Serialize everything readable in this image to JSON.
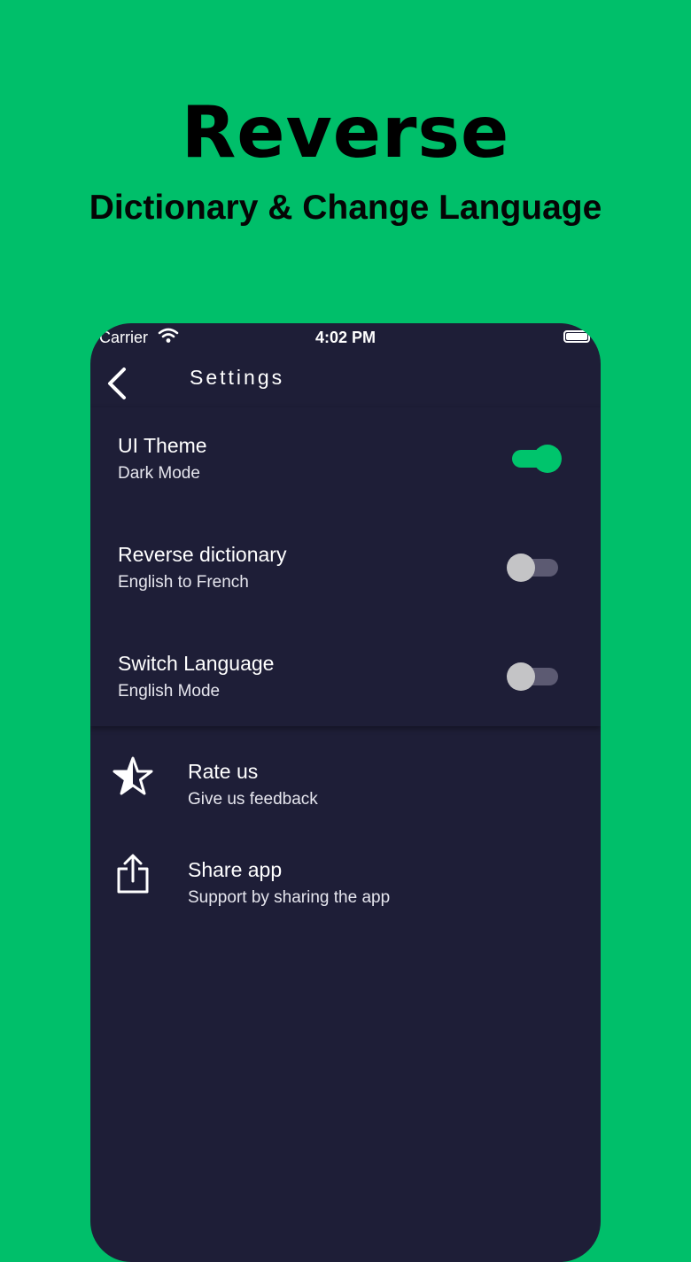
{
  "promo": {
    "title": "Reverse",
    "subtitle": "Dictionary & Change Language"
  },
  "status_bar": {
    "carrier": "Carrier",
    "time": "4:02 PM"
  },
  "nav": {
    "title": "Settings"
  },
  "settings": [
    {
      "title": "UI Theme",
      "subtitle": "Dark Mode",
      "enabled": true
    },
    {
      "title": "Reverse dictionary",
      "subtitle": "English to French",
      "enabled": false
    },
    {
      "title": "Switch Language",
      "subtitle": "English Mode",
      "enabled": false
    }
  ],
  "actions": [
    {
      "title": "Rate us",
      "subtitle": "Give us feedback",
      "icon": "star-icon"
    },
    {
      "title": "Share app",
      "subtitle": "Support by sharing the app",
      "icon": "share-icon"
    }
  ],
  "colors": {
    "background": "#00bf6a",
    "panel": "#1e1e37",
    "accent": "#00c46c"
  }
}
